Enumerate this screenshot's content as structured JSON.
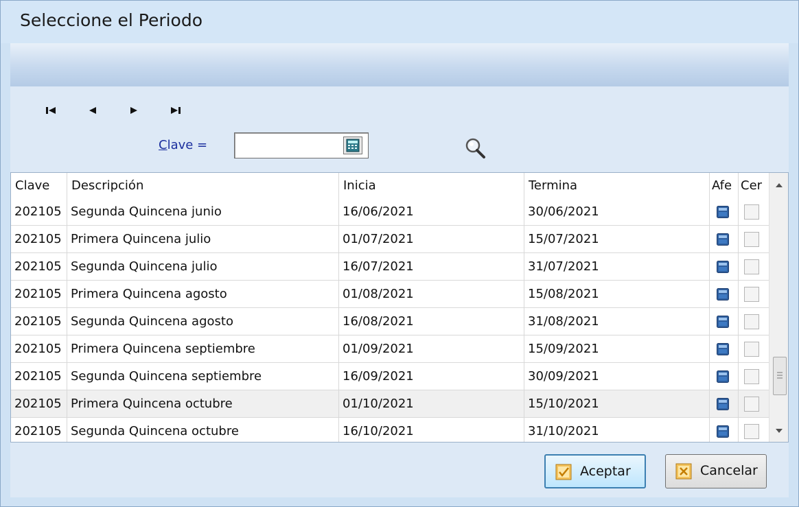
{
  "window": {
    "title": "Seleccione el Periodo"
  },
  "colors": {
    "accent": "#3c7fb1",
    "label_blue": "#1b2f9e",
    "afecta_box": "#3a6fb0"
  },
  "nav": [
    {
      "name": "first-record-icon"
    },
    {
      "name": "previous-record-icon"
    },
    {
      "name": "next-record-icon"
    },
    {
      "name": "last-record-icon"
    }
  ],
  "filter": {
    "label_accel": "C",
    "label_rest": "lave =",
    "value": ""
  },
  "grid": {
    "columns": [
      "Clave",
      "Descripción",
      "Inicia",
      "Termina",
      "Afe",
      "Cer"
    ],
    "rows": [
      {
        "clave": "202105",
        "descripcion": "Segunda Quincena junio",
        "inicia": "16/06/2021",
        "termina": "30/06/2021",
        "afecta": true,
        "cerrado": false
      },
      {
        "clave": "202105",
        "descripcion": "Primera Quincena julio",
        "inicia": "01/07/2021",
        "termina": "15/07/2021",
        "afecta": true,
        "cerrado": false
      },
      {
        "clave": "202105",
        "descripcion": "Segunda Quincena julio",
        "inicia": "16/07/2021",
        "termina": "31/07/2021",
        "afecta": true,
        "cerrado": false
      },
      {
        "clave": "202105",
        "descripcion": "Primera Quincena agosto",
        "inicia": "01/08/2021",
        "termina": "15/08/2021",
        "afecta": true,
        "cerrado": false
      },
      {
        "clave": "202105",
        "descripcion": "Segunda Quincena agosto",
        "inicia": "16/08/2021",
        "termina": "31/08/2021",
        "afecta": true,
        "cerrado": false
      },
      {
        "clave": "202105",
        "descripcion": "Primera Quincena septiembre",
        "inicia": "01/09/2021",
        "termina": "15/09/2021",
        "afecta": true,
        "cerrado": false
      },
      {
        "clave": "202105",
        "descripcion": "Segunda Quincena septiembre",
        "inicia": "16/09/2021",
        "termina": "30/09/2021",
        "afecta": true,
        "cerrado": false
      },
      {
        "clave": "202105",
        "descripcion": "Primera Quincena octubre",
        "inicia": "01/10/2021",
        "termina": "15/10/2021",
        "afecta": true,
        "cerrado": false,
        "highlighted": true
      },
      {
        "clave": "202105",
        "descripcion": "Segunda Quincena octubre",
        "inicia": "16/10/2021",
        "termina": "31/10/2021",
        "afecta": true,
        "cerrado": false
      }
    ]
  },
  "buttons": {
    "ok_label": "Aceptar",
    "cancel_label": "Cancelar"
  }
}
